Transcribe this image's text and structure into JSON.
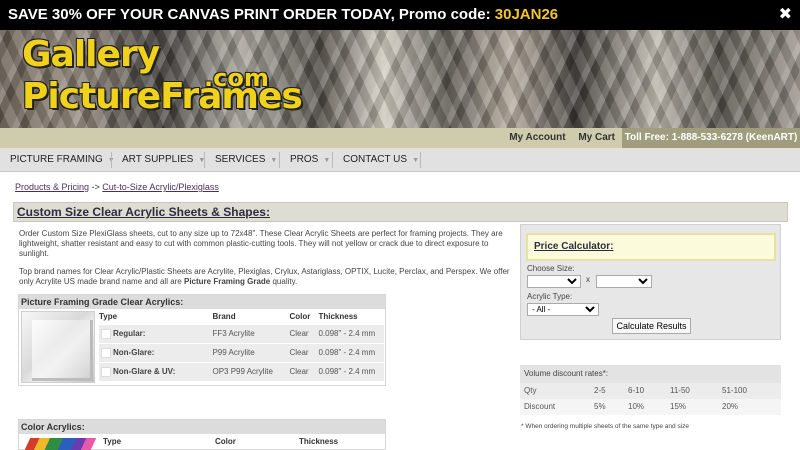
{
  "promo": {
    "text": "SAVE 30% OFF YOUR CANVAS PRINT ORDER TODAY, Promo code:",
    "code": "30JAN26",
    "close": "✖"
  },
  "logo": {
    "line1": "Gallery",
    "com": ".com",
    "line2": "PictureFrames"
  },
  "account_bar": {
    "my_account": "My Account",
    "my_cart": "My Cart",
    "toll_free": "Toll Free: 1-888-533-6278 (KeenART)"
  },
  "nav": {
    "caret": "▼",
    "items": [
      {
        "label": "PICTURE FRAMING"
      },
      {
        "label": "ART SUPPLIES"
      },
      {
        "label": "SERVICES"
      },
      {
        "label": "PROS"
      },
      {
        "label": "CONTACT US"
      }
    ]
  },
  "breadcrumb": {
    "first": "Products & Pricing",
    "sep": " -> ",
    "second": "Cut-to-Size Acrylic/Plexiglass"
  },
  "page_title": "Custom Size Clear Acrylic Sheets & Shapes:",
  "para1": "Order Custom Size PlexiGlass sheets, cut to any size up to 72x48\". These Clear Acrylic Sheets are perfect for framing projects. They are lightweight, shatter resistant and easy to cut with common plastic-cutting tools. They will not yellow or crack due to direct exposure to sunlight.",
  "para2": {
    "text": "Top brand names for Clear Acrylic/Plastic Sheets are Acrylite, Plexiglas, Crylux, Astariglass, OPTIX, Lucite, Perclax, and Perspex. We offer only Acrylite US made brand name and all are",
    "bold": "Picture Framing Grade",
    "end": "quality."
  },
  "acrylic_table": {
    "header": "Picture Framing Grade Clear Acrylics:",
    "columns": [
      "Type",
      "Brand",
      "Color",
      "Thickness"
    ],
    "rows": [
      {
        "type": "Regular:",
        "brand": "FF3 Acrylite",
        "color": "Clear",
        "thickness": "0.098\" - 2.4 mm"
      },
      {
        "type": "Non-Glare:",
        "brand": "P99 Acrylite",
        "color": "Clear",
        "thickness": "0.098\" - 2.4 mm"
      },
      {
        "type": "Non-Glare & UV:",
        "brand": "OP3 P99 Acrylite",
        "color": "Clear",
        "thickness": "0.098\" - 2.4 mm"
      }
    ]
  },
  "color_table": {
    "header": "Color Acrylics:",
    "columns": [
      "Type",
      "Color",
      "Thickness"
    ]
  },
  "calculator": {
    "title": "Price Calculator:",
    "choose_size": "Choose Size:",
    "x": "x",
    "acrylic_type": "Acrylic Type:",
    "type_selected": "- All -",
    "button": "Calculate Results"
  },
  "volume": {
    "title": "Volume discount rates*:",
    "qty_label": "Qty",
    "qty": [
      "2-5",
      "6-10",
      "11-50",
      "51-100"
    ],
    "discount_label": "Discount",
    "discount": [
      "5%",
      "10%",
      "15%",
      "20%"
    ],
    "note": "* When ordering multiple sheets of the same type and size"
  },
  "colors": {
    "promo_code": "#f3c623",
    "logo_yellow": "#f0d21a",
    "account_bar": "#cfccad",
    "toll_free_bg": "#a09d7e",
    "nav_bg": "#e1e1e1",
    "calc_box_bg": "#fbfbdc"
  }
}
